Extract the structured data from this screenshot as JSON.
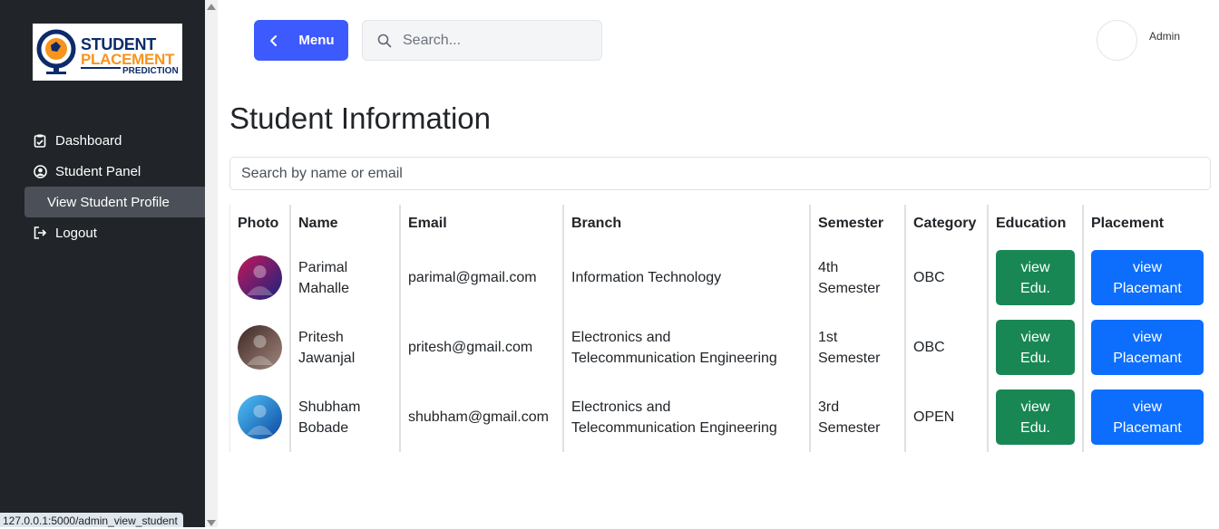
{
  "brand": {
    "line1": "STUDENT",
    "line2": "PLACEMENT",
    "line3": "PREDICTION"
  },
  "sidebar": {
    "items": [
      {
        "label": "Dashboard",
        "icon": "clipboard-check-icon"
      },
      {
        "label": "Student Panel",
        "icon": "user-circle-icon"
      },
      {
        "label": "View Student Profile",
        "icon": ""
      },
      {
        "label": "Logout",
        "icon": "logout-icon"
      }
    ]
  },
  "status_bar": {
    "url": "127.0.0.1:5000/admin_view_student"
  },
  "header": {
    "menu_label": "Menu",
    "search_placeholder": "Search...",
    "user_name": "Admin"
  },
  "main": {
    "title": "Student Information",
    "filter_placeholder": "Search by name or email",
    "columns": [
      "Photo",
      "Name",
      "Email",
      "Branch",
      "Semester",
      "Category",
      "Education",
      "Placement"
    ],
    "rows": [
      {
        "name_first": "Parimal",
        "name_last": "Mahalle",
        "email": "parimal@gmail.com",
        "branch_l1": "Information Technology",
        "branch_l2": "",
        "sem_l1": "4th",
        "sem_l2": "Semester",
        "category": "OBC",
        "edu_l1": "view",
        "edu_l2": "Edu.",
        "pl_l1": "view",
        "pl_l2": "Placemant",
        "photo_colors": [
          "#c2185b",
          "#1a237e"
        ]
      },
      {
        "name_first": "Pritesh",
        "name_last": "Jawanjal",
        "email": "pritesh@gmail.com",
        "branch_l1": "Electronics and",
        "branch_l2": "Telecommunication Engineering",
        "sem_l1": "1st",
        "sem_l2": "Semester",
        "category": "OBC",
        "edu_l1": "view",
        "edu_l2": "Edu.",
        "pl_l1": "view",
        "pl_l2": "Placemant",
        "photo_colors": [
          "#3e2723",
          "#a1887f"
        ]
      },
      {
        "name_first": "Shubham",
        "name_last": "Bobade",
        "email": "shubham@gmail.com",
        "branch_l1": "Electronics and",
        "branch_l2": "Telecommunication Engineering",
        "sem_l1": "3rd",
        "sem_l2": "Semester",
        "category": "OPEN",
        "edu_l1": "view",
        "edu_l2": "Edu.",
        "pl_l1": "view",
        "pl_l2": "Placemant",
        "photo_colors": [
          "#4fc3f7",
          "#0d47a1"
        ]
      }
    ]
  },
  "colors": {
    "sidebar_bg": "#212529",
    "menu_button": "#3d5afe",
    "education_button": "#198754",
    "placement_button": "#0d6efd"
  }
}
